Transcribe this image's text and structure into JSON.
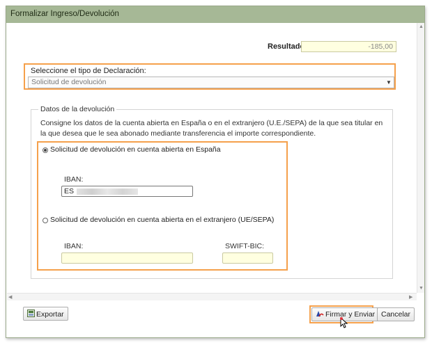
{
  "window": {
    "title": "Formalizar Ingreso/Devolución"
  },
  "resultado": {
    "label": "Resultado",
    "value": "-185,00"
  },
  "declaracion": {
    "label": "Seleccione el tipo de Declaración:",
    "selected": "Solicitud de devolución"
  },
  "datos": {
    "legend": "Datos de la devolución",
    "description": "Consigne los datos de la cuenta abierta en España o en el extranjero (U.E./SEPA) de la que sea titular en la que desea que le sea abonado mediante transferencia el importe correspondiente.",
    "option_spain": {
      "label": "Solicitud de devolución en cuenta abierta en España",
      "selected": true,
      "iban_label": "IBAN:",
      "iban_value": "ES"
    },
    "option_foreign": {
      "label": "Solicitud de devolución en cuenta abierta en el extranjero (UE/SEPA)",
      "selected": false,
      "iban_label": "IBAN:",
      "iban_value": "",
      "swift_label": "SWIFT-BIC:",
      "swift_value": ""
    }
  },
  "footer": {
    "export_label": "Exportar",
    "sign_label": "Firmar y Enviar",
    "cancel_label": "Cancelar"
  },
  "colors": {
    "highlight": "#f5a04b",
    "titlebar": "#a6b896",
    "input_yellow": "#ffffe0"
  }
}
